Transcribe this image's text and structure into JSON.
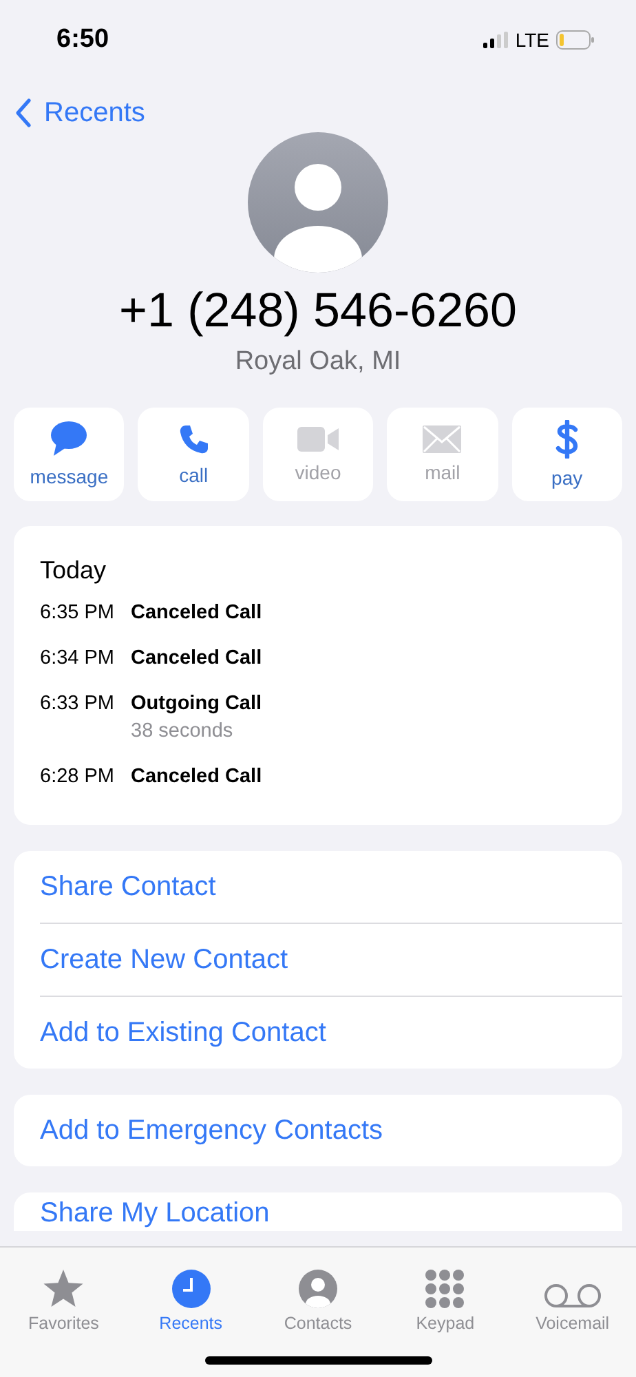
{
  "status_bar": {
    "time": "6:50",
    "network": "LTE"
  },
  "nav": {
    "back_label": "Recents"
  },
  "contact": {
    "number": "+1 (248) 546-6260",
    "location": "Royal Oak, MI"
  },
  "actions": [
    {
      "kind": "message",
      "label": "message",
      "disabled": false
    },
    {
      "kind": "call",
      "label": "call",
      "disabled": false
    },
    {
      "kind": "video",
      "label": "video",
      "disabled": true
    },
    {
      "kind": "mail",
      "label": "mail",
      "disabled": true
    },
    {
      "kind": "pay",
      "label": "pay",
      "disabled": false
    }
  ],
  "history": {
    "heading": "Today",
    "entries": [
      {
        "time": "6:35 PM",
        "type": "Canceled Call"
      },
      {
        "time": "6:34 PM",
        "type": "Canceled Call"
      },
      {
        "time": "6:33 PM",
        "type": "Outgoing Call",
        "detail": "38 seconds"
      },
      {
        "time": "6:28 PM",
        "type": "Canceled Call"
      }
    ]
  },
  "option_groups": [
    [
      "Share Contact",
      "Create New Contact",
      "Add to Existing Contact"
    ],
    [
      "Add to Emergency Contacts"
    ],
    [
      "Share My Location"
    ]
  ],
  "tab_bar": [
    {
      "kind": "favorites",
      "label": "Favorites",
      "selected": false
    },
    {
      "kind": "recents",
      "label": "Recents",
      "selected": true
    },
    {
      "kind": "contacts",
      "label": "Contacts",
      "selected": false
    },
    {
      "kind": "keypad",
      "label": "Keypad",
      "selected": false
    },
    {
      "kind": "voicemail",
      "label": "Voicemail",
      "selected": false
    }
  ]
}
